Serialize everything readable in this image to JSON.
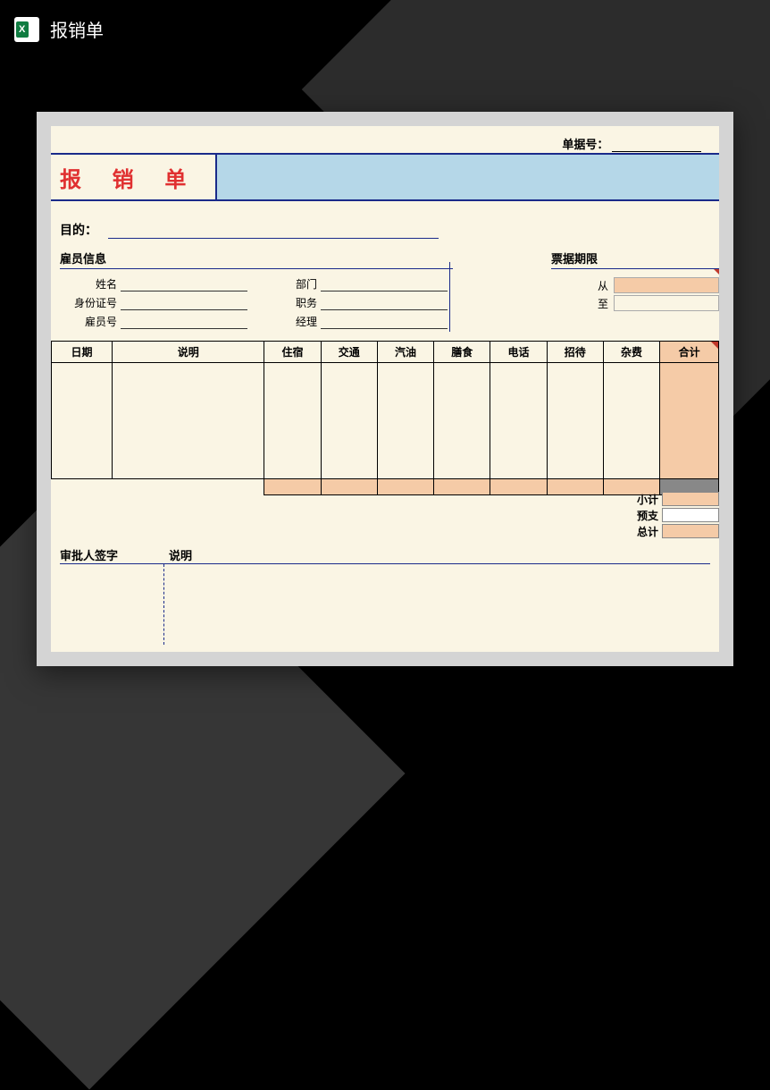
{
  "header": {
    "file_title": "报销单"
  },
  "doc": {
    "receipt_no_label": "单据号：",
    "title": "报 销 单",
    "purpose_label": "目的：",
    "employee_section_title": "雇员信息",
    "fields": {
      "name": "姓名",
      "id_card": "身份证号",
      "emp_no": "雇员号",
      "dept": "部门",
      "position": "职务",
      "manager": "经理"
    },
    "period_section_title": "票据期限",
    "period": {
      "from": "从",
      "to": "至"
    },
    "table_headers": {
      "date": "日期",
      "desc": "说明",
      "lodging": "住宿",
      "transport": "交通",
      "fuel": "汽油",
      "meals": "膳食",
      "phone": "电话",
      "entertain": "招待",
      "misc": "杂费",
      "total": "合计"
    },
    "summary": {
      "subtotal": "小计",
      "advance": "预支",
      "grand_total": "总计"
    },
    "approver_section_title": "审批人签字",
    "approver_notes_title": "说明"
  }
}
